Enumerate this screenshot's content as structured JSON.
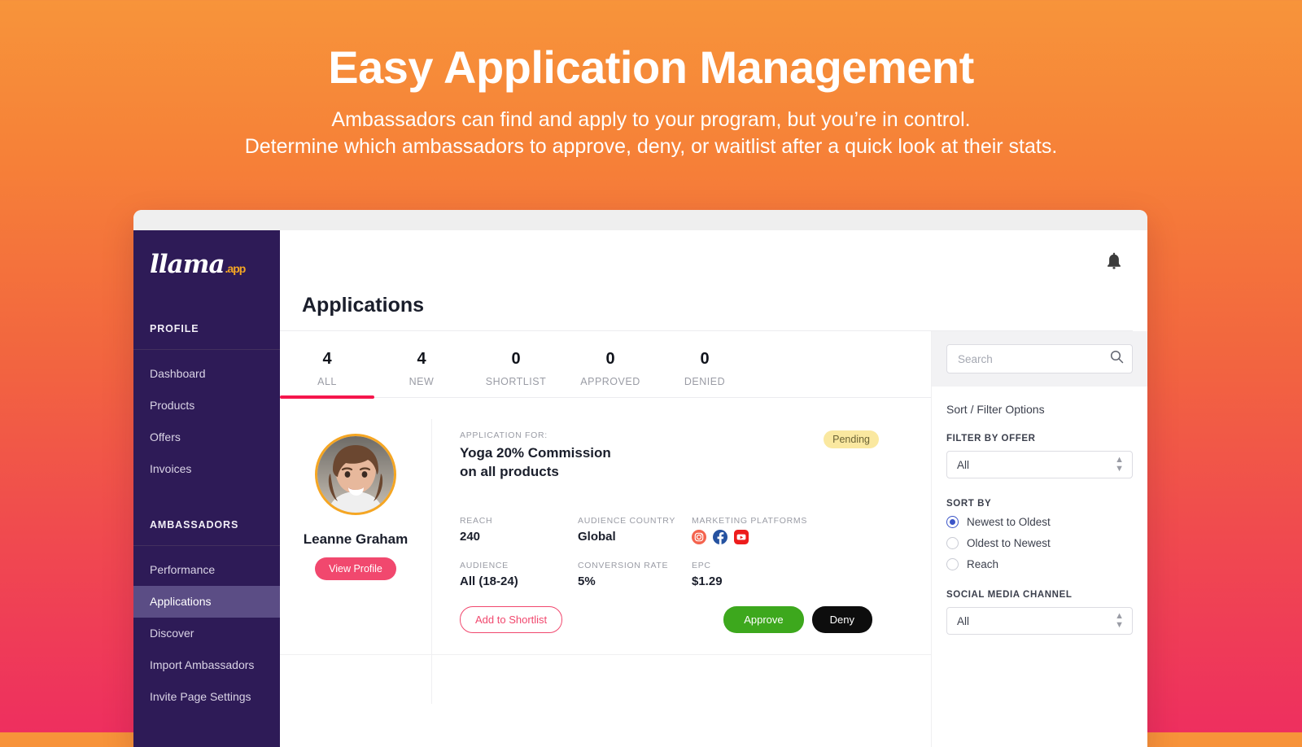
{
  "hero": {
    "title": "Easy Application Management",
    "subtitle_line1": "Ambassadors can find and apply to your program, but you’re in control.",
    "subtitle_line2": "Determine which ambassadors to approve, deny, or waitlist after a quick look at their stats."
  },
  "colors": {
    "gradient_top": "#F7943A",
    "gradient_bottom": "#EE2F5F",
    "sidebar_bg": "#2E1B57",
    "sidebar_active": "#5B4D85",
    "accent_pink": "#F1486E",
    "tab_underline": "#F5164C",
    "approve_green": "#3DA81D",
    "deny_black": "#0D0D0D",
    "badge_yellow": "#FAE8A0",
    "radio_blue": "#3B55C8",
    "logo_app_orange": "#F5A623"
  },
  "sidebar": {
    "logo_text": "llama",
    "logo_suffix": ".app",
    "sections": [
      {
        "heading": "PROFILE",
        "items": [
          {
            "label": "Dashboard",
            "active": false
          },
          {
            "label": "Products",
            "active": false
          },
          {
            "label": "Offers",
            "active": false
          },
          {
            "label": "Invoices",
            "active": false
          }
        ]
      },
      {
        "heading": "AMBASSADORS",
        "items": [
          {
            "label": "Performance",
            "active": false
          },
          {
            "label": "Applications",
            "active": true
          },
          {
            "label": "Discover",
            "active": false
          },
          {
            "label": "Import Ambassadors",
            "active": false
          },
          {
            "label": "Invite Page Settings",
            "active": false
          }
        ]
      }
    ]
  },
  "topbar": {
    "notification_icon": "bell-icon"
  },
  "page": {
    "title": "Applications"
  },
  "tabs": [
    {
      "count": "4",
      "label": "ALL",
      "active": true
    },
    {
      "count": "4",
      "label": "NEW",
      "active": false
    },
    {
      "count": "0",
      "label": "SHORTLIST",
      "active": false
    },
    {
      "count": "0",
      "label": "APPROVED",
      "active": false
    },
    {
      "count": "0",
      "label": "DENIED",
      "active": false
    }
  ],
  "application": {
    "person_name": "Leanne Graham",
    "view_profile_label": "View Profile",
    "application_for_label": "APPLICATION FOR:",
    "offer_title_line1": "Yoga 20% Commission",
    "offer_title_line2": "on all products",
    "status_badge": "Pending",
    "stats": [
      {
        "label": "REACH",
        "value": "240"
      },
      {
        "label": "AUDIENCE COUNTRY",
        "value": "Global"
      },
      {
        "label": "MARKETING PLATFORMS",
        "value": ""
      },
      {
        "label": "AUDIENCE",
        "value": "All (18-24)"
      },
      {
        "label": "CONVERSION RATE",
        "value": "5%"
      },
      {
        "label": "EPC",
        "value": "$1.29"
      }
    ],
    "platforms": [
      "instagram-icon",
      "facebook-icon",
      "youtube-icon"
    ],
    "buttons": {
      "shortlist": "Add to Shortlist",
      "approve": "Approve",
      "deny": "Deny"
    }
  },
  "filters": {
    "search_placeholder": "Search",
    "search_value": "",
    "search_icon": "search-icon",
    "heading": "Sort / Filter Options",
    "filter_by_offer_label": "FILTER BY OFFER",
    "filter_by_offer_value": "All",
    "sort_by_label": "SORT BY",
    "sort_options": [
      {
        "label": "Newest to Oldest",
        "checked": true
      },
      {
        "label": "Oldest to Newest",
        "checked": false
      },
      {
        "label": "Reach",
        "checked": false
      }
    ],
    "social_media_label": "SOCIAL MEDIA CHANNEL",
    "social_media_value": "All"
  }
}
